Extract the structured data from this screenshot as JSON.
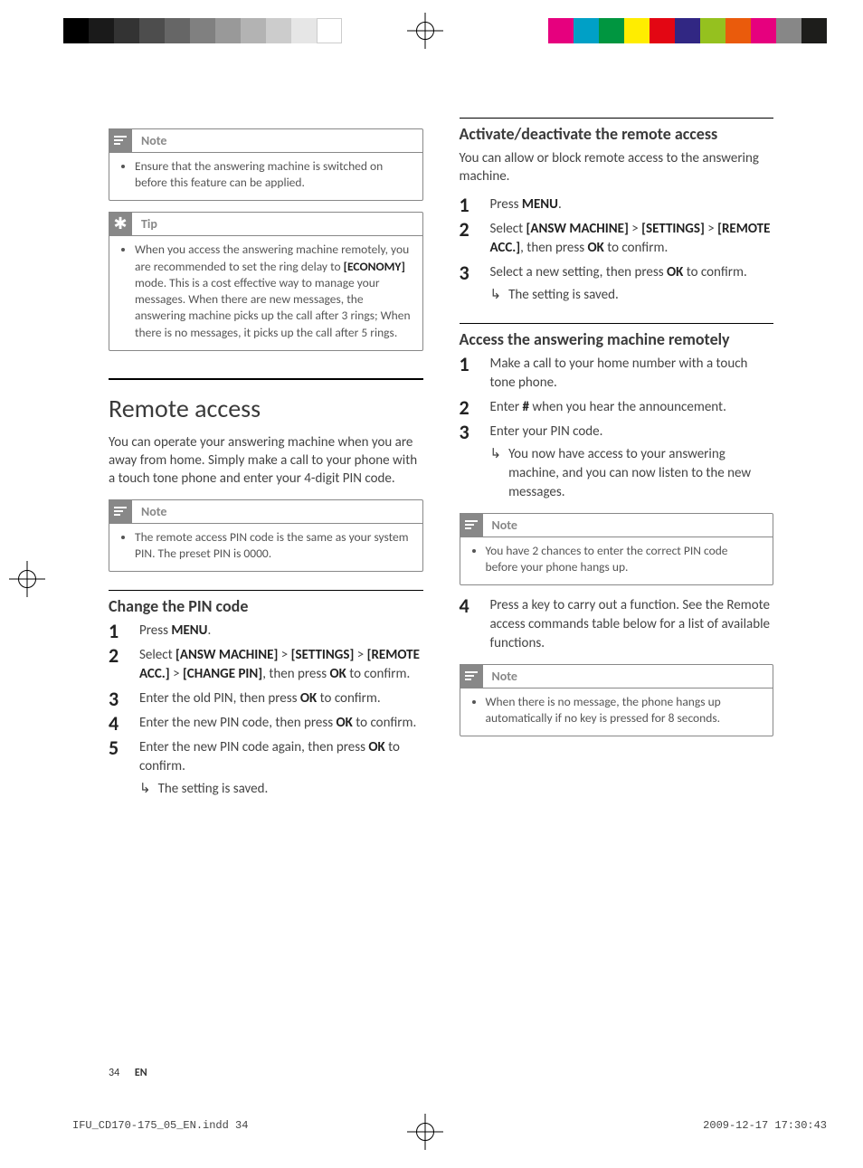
{
  "boxes": {
    "note1": {
      "title": "Note",
      "item": "Ensure that the answering machine is switched on before this feature can be applied."
    },
    "tip1": {
      "title": "Tip",
      "item_prefix": "When you access the answering machine remotely, you are recommended to set the ring delay to ",
      "item_bold": "[ECONOMY]",
      "item_suffix": " mode. This is a cost effective way to manage your messages. When there are new messages, the answering machine picks up the call after 3 rings; When there is no messages, it picks up the call after 5 rings."
    },
    "note2": {
      "title": "Note",
      "item": "The remote access PIN code is the same as your system PIN. The preset PIN is 0000."
    },
    "note3": {
      "title": "Note",
      "item": "You have 2 chances to enter the correct PIN code before your phone hangs up."
    },
    "note4": {
      "title": "Note",
      "item": "When there is no message, the phone hangs up automatically if no key is pressed for 8 seconds."
    }
  },
  "left": {
    "h1": "Remote access",
    "intro": "You can operate your answering machine when you are away from home. Simply make a call to your phone with a touch tone phone and enter your 4-digit PIN code.",
    "h2": "Change the PIN code",
    "steps": {
      "s1a": "Press ",
      "s1b": "MENU",
      "s1c": ".",
      "s2a": "Select ",
      "s2b": "[ANSW MACHINE]",
      "s2c": " > ",
      "s2d": "[SETTINGS]",
      "s2e": " > ",
      "s2f": "[REMOTE ACC.]",
      "s2g": " > ",
      "s2h": "[CHANGE PIN]",
      "s2i": ", then press ",
      "s2j": "OK",
      "s2k": " to confirm.",
      "s3a": "Enter the old PIN, then press ",
      "s3b": "OK",
      "s3c": " to confirm.",
      "s4a": "Enter the new PIN code, then press ",
      "s4b": "OK",
      "s4c": " to confirm.",
      "s5a": "Enter the new PIN code again, then press ",
      "s5b": "OK",
      "s5c": " to confirm.",
      "result": "The setting is saved."
    }
  },
  "right": {
    "h2a": "Activate/deactivate the remote access",
    "introA": "You can allow or block remote access to the answering machine.",
    "stepsA": {
      "s1a": "Press ",
      "s1b": "MENU",
      "s1c": ".",
      "s2a": "Select ",
      "s2b": "[ANSW MACHINE]",
      "s2c": " > ",
      "s2d": "[SETTINGS]",
      "s2e": " > ",
      "s2f": "[REMOTE ACC.]",
      "s2g": ", then press ",
      "s2h": "OK",
      "s2i": " to confirm.",
      "s3a": "Select a new setting, then press ",
      "s3b": "OK",
      "s3c": " to confirm.",
      "result": "The setting is saved."
    },
    "h2b": "Access the answering machine remotely",
    "stepsB": {
      "s1": "Make a call to your home number with a touch tone phone.",
      "s2a": "Enter ",
      "s2b": "#",
      "s2c": " when you hear the announcement.",
      "s3": "Enter your PIN code.",
      "result3": "You now have access to your answering machine, and you can now listen to the new messages.",
      "s4": "Press a key to carry out a function. See the Remote access commands table below for a list of available functions."
    }
  },
  "footer": {
    "page": "34",
    "lang": "EN"
  },
  "printline": {
    "left": "IFU_CD170-175_05_EN.indd   34",
    "right": "2009-12-17   17:30:43"
  }
}
